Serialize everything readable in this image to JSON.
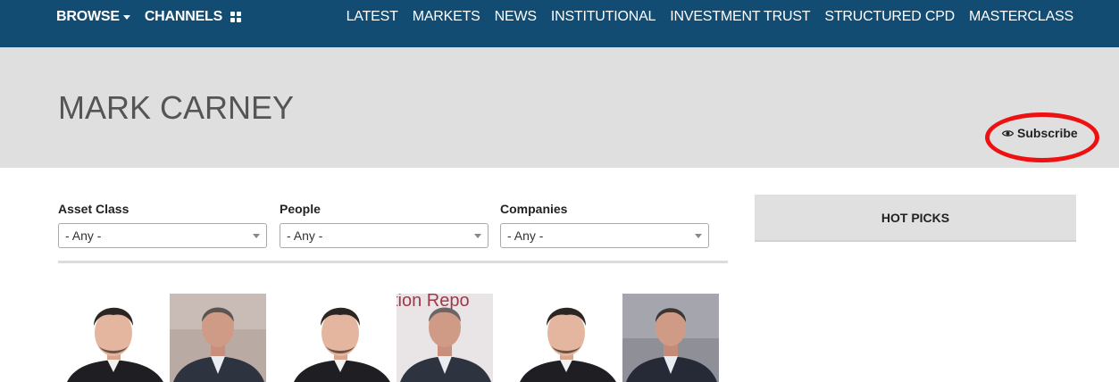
{
  "nav": {
    "browse_label": "BROWSE",
    "channels_label": "CHANNELS",
    "links": [
      "LATEST",
      "MARKETS",
      "NEWS",
      "INSTITUTIONAL",
      "INVESTMENT TRUST",
      "STRUCTURED CPD",
      "MASTERCLASS"
    ]
  },
  "hero": {
    "title": "MARK CARNEY",
    "subscribe_label": "Subscribe",
    "subscribe_icon": "eye-icon"
  },
  "filters": [
    {
      "label": "Asset Class",
      "value": "- Any -"
    },
    {
      "label": "People",
      "value": "- Any -"
    },
    {
      "label": "Companies",
      "value": "- Any -"
    }
  ],
  "sidebar": {
    "hot_picks_label": "HOT PICKS"
  },
  "colors": {
    "nav_bg": "#134c72",
    "hero_bg": "#dfdfdf",
    "highlight_ring": "#ee1111"
  },
  "thumbnails": [
    {
      "caption_fragment": ""
    },
    {
      "caption_fragment": "tion Repo"
    },
    {
      "caption_fragment": ""
    }
  ]
}
